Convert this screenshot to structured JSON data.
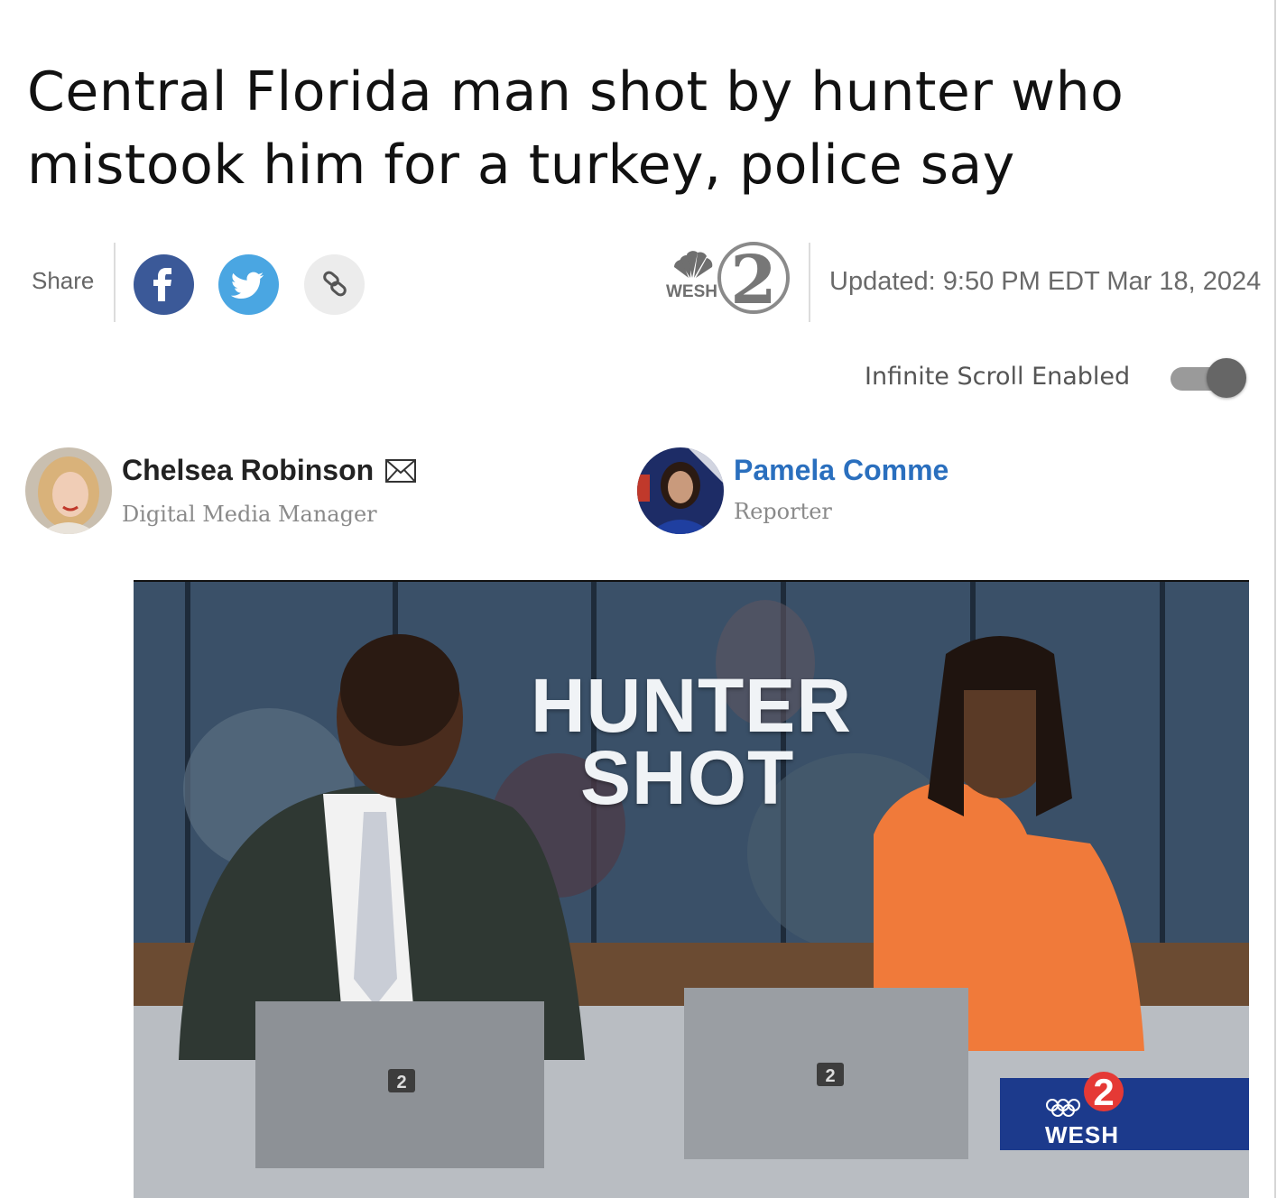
{
  "article": {
    "headline": "Central Florida man shot by hunter who mistook him for a turkey, police say",
    "updated": "Updated: 9:50 PM EDT Mar 18, 2024"
  },
  "share": {
    "label": "Share",
    "buttons": [
      {
        "name": "facebook",
        "icon": "facebook-icon",
        "color": "#3b5998"
      },
      {
        "name": "twitter",
        "icon": "twitter-bird-icon",
        "color": "#4aa6e2"
      },
      {
        "name": "copy-link",
        "icon": "link-icon",
        "color": "#ececec"
      }
    ]
  },
  "station_logo": {
    "icon": "wesh-2-logo",
    "text": "WESH"
  },
  "infinite_scroll": {
    "label": "Infinite Scroll Enabled",
    "enabled": true,
    "accent": "#666666"
  },
  "authors": [
    {
      "name": "Chelsea Robinson",
      "role": "Digital Media Manager",
      "icon": "mail-icon"
    },
    {
      "name": "Pamela Comme",
      "role": "Reporter",
      "color": "#2a6fbe"
    }
  ],
  "video": {
    "graphic_line1": "HUNTER",
    "graphic_line2": "SHOT",
    "bug_text": "WESH",
    "laptop_logo": "2"
  }
}
